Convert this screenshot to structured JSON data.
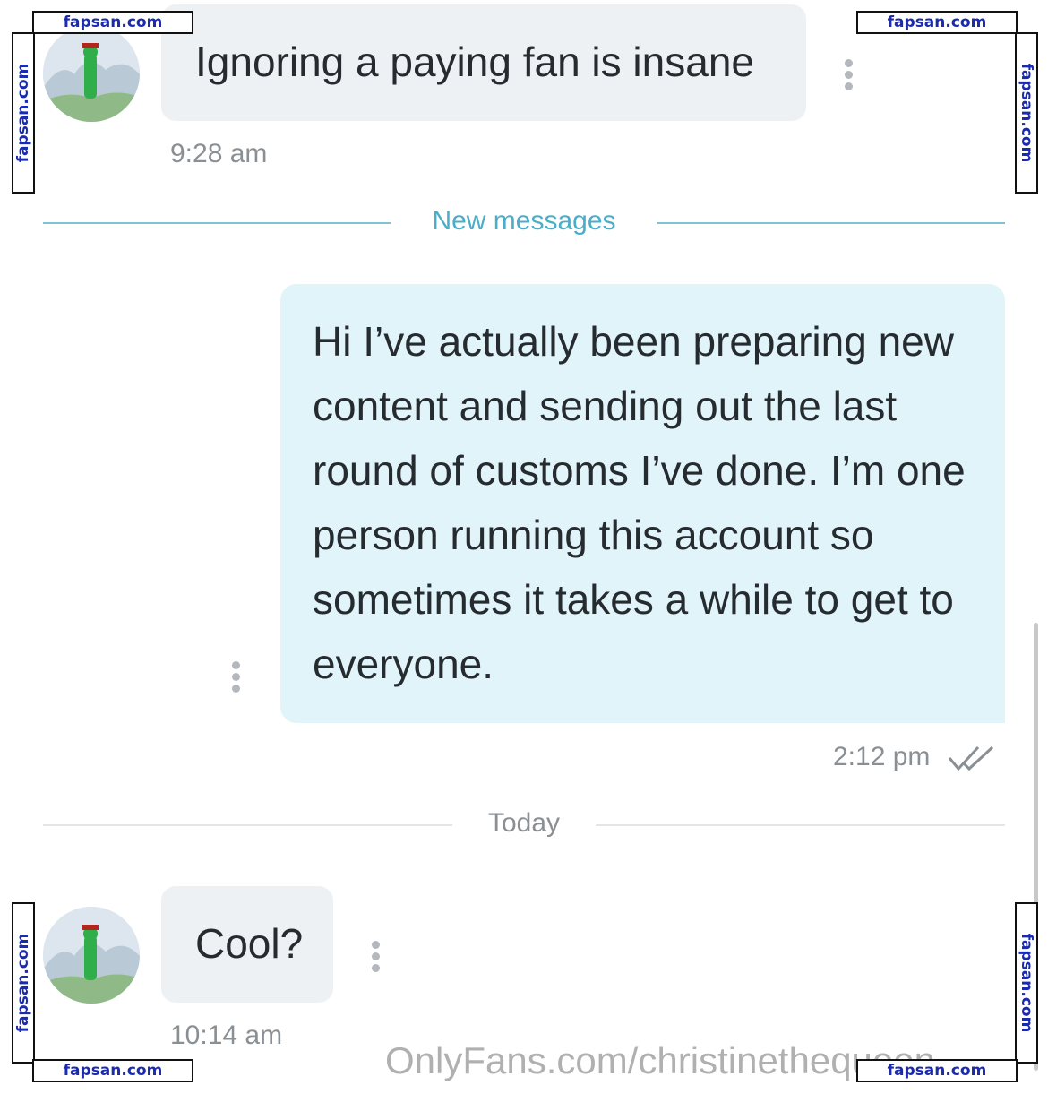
{
  "messages": [
    {
      "direction": "in",
      "text": "Ignoring a paying fan is insane",
      "time": "9:28 am"
    },
    {
      "direction": "out",
      "text": "Hi I’ve actually been preparing new content and sending out the last round of customs I’ve done. I’m one person running this account so sometimes it takes a while to get to everyone.",
      "time": "2:12 pm",
      "status_icon": "double-check-icon"
    },
    {
      "direction": "in",
      "text": "Cool?",
      "time": "10:14 am"
    }
  ],
  "dividers": {
    "new_messages": "New messages",
    "today": "Today"
  },
  "watermarks": {
    "site": "fapsan.com",
    "onlyfans": "OnlyFans.com/christinethequeen"
  },
  "colors": {
    "accent_teal": "#4aaec8",
    "bubble_in": "#eef1f3",
    "bubble_out": "#e0f4fa",
    "watermark_blue": "#1a2bb0"
  }
}
